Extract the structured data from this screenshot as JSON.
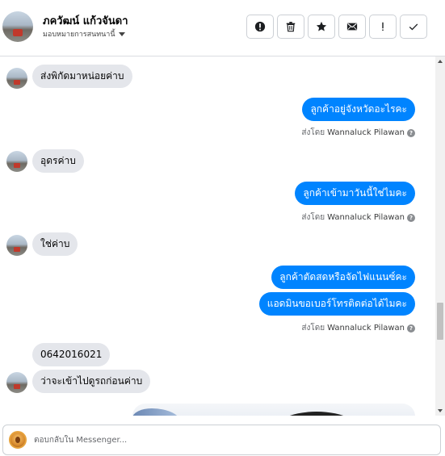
{
  "header": {
    "contact_name": "ภควัฒน์ แก้วจันดา",
    "assign_label": "มอบหมายการสนทนานี้",
    "toolbar": [
      {
        "icon": "alert-circle-icon"
      },
      {
        "icon": "trash-icon"
      },
      {
        "icon": "star-icon"
      },
      {
        "icon": "envelope-icon"
      },
      {
        "icon": "exclamation-icon"
      },
      {
        "icon": "check-icon"
      }
    ]
  },
  "messages": [
    {
      "direction": "in",
      "text": "ส่งพิกัดมาหน่อยค่าบ"
    },
    {
      "direction": "out",
      "text": "ลูกค้าอยู่จังหวัดอะไรคะ"
    },
    {
      "direction": "in",
      "text": "อุดรค่าบ"
    },
    {
      "direction": "out",
      "text": "ลูกค้าเข้ามาวันนี้ใช่ไมคะ"
    },
    {
      "direction": "in",
      "text": "ใช่ค่าบ"
    },
    {
      "direction": "out",
      "text": "ลูกค้าตัดสดหรือจัดไฟแนนซ์คะ"
    },
    {
      "direction": "out",
      "text": "แอดมินขอเบอร์โทรติดต่อได้ไมคะ"
    },
    {
      "direction": "in",
      "text": "0642016021"
    },
    {
      "direction": "in",
      "text": "ว่าจะเข้าไปดูรถก่อนค่าบ"
    }
  ],
  "sent_by": {
    "prefix": "ส่งโดย",
    "name": "Wannaluck Pilawan"
  },
  "composer": {
    "placeholder": "ตอบกลับใน Messenger..."
  },
  "colors": {
    "outgoing_bubble": "#0084ff",
    "incoming_bubble": "#e4e6eb"
  }
}
